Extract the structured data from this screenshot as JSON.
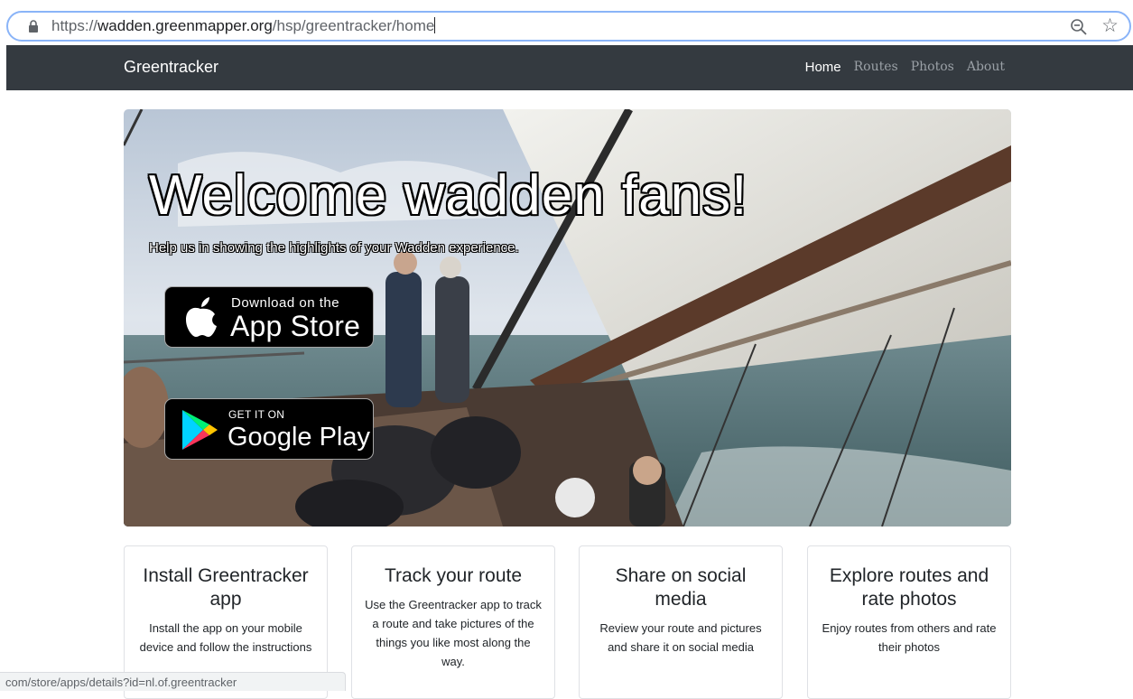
{
  "browser": {
    "url_scheme": "https://",
    "url_domain": "wadden.greenmapper.org",
    "url_path": "/hsp/greentracker/home"
  },
  "navbar": {
    "brand": "Greentracker",
    "links": [
      {
        "label": "Home",
        "active": true
      },
      {
        "label": "Routes",
        "active": false
      },
      {
        "label": "Photos",
        "active": false
      },
      {
        "label": "About",
        "active": false
      }
    ]
  },
  "hero": {
    "title": "Welcome wadden fans!",
    "subtitle": "Help us in showing the highlights of your Wadden experience."
  },
  "badges": {
    "apple": {
      "top_line": "Download on the",
      "main_line": "App Store"
    },
    "google": {
      "top_line": "GET IT ON",
      "main_line": "Google Play"
    }
  },
  "cards": [
    {
      "title": "Install Greentracker app",
      "text": "Install the app on your mobile device and follow the instructions"
    },
    {
      "title": "Track your route",
      "text": "Use the Greentracker app to track a route and take pictures of the things you like most along the way."
    },
    {
      "title": "Share on social media",
      "text": "Review your route and pictures and share it on social media"
    },
    {
      "title": "Explore routes and rate photos",
      "text": "Enjoy routes from others and rate their photos"
    }
  ],
  "status_bar": {
    "text": "com/store/apps/details?id=nl.of.greentracker"
  },
  "colors": {
    "navbar_bg": "#343a40",
    "address_border": "#8ab4f8"
  }
}
